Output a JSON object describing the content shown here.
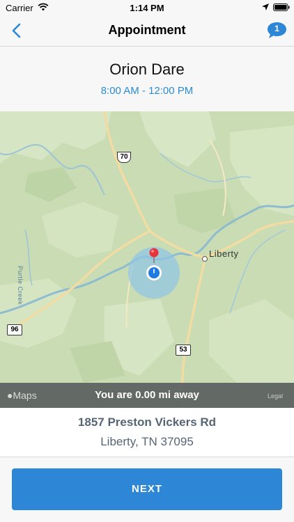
{
  "status_bar": {
    "carrier": "Carrier",
    "time": "1:14 PM"
  },
  "nav": {
    "title": "Appointment",
    "message_count": "1"
  },
  "appointment": {
    "customer_name": "Orion Dare",
    "time_window": "8:00 AM - 12:00 PM"
  },
  "map": {
    "place_label": "Liberty",
    "creek_label": "Purtle Creek",
    "route_shields": [
      "70",
      "96",
      "53"
    ],
    "attribution": "Maps",
    "distance_text": "You are 0.00 mi away",
    "legal": "Legal"
  },
  "address": {
    "line1": "1857 Preston Vickers Rd",
    "line2": "Liberty, TN 37095"
  },
  "footer": {
    "next_label": "NEXT"
  },
  "colors": {
    "accent": "#2e86d7",
    "time_window": "#2b8bd4",
    "address_text": "#566575",
    "pin": "#e8333a"
  },
  "icons": {
    "back": "chevron-left-icon",
    "messages": "speech-bubble-icon",
    "pin": "map-pin-icon",
    "user_location": "user-location-icon"
  }
}
